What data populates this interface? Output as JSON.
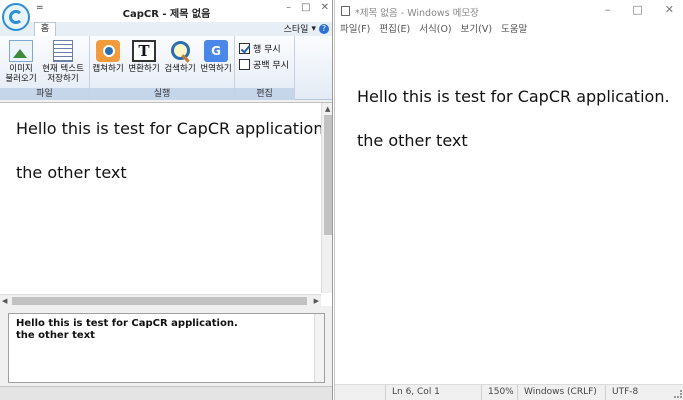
{
  "capcr": {
    "title": "CapCR - 제목 없음",
    "qat_symbol": "=",
    "window_controls": [
      "–",
      "□",
      "✕"
    ],
    "tab_home": "홈",
    "style_menu": "스타일",
    "style_arrow": "▾",
    "help_symbol": "?",
    "groups": {
      "file": {
        "label": "파일",
        "load_image": "이미지\n불러오기",
        "save_text": "현재 텍스트\n저장하기"
      },
      "run": {
        "label": "실행",
        "capture": "캡쳐하기",
        "convert": "변환하기",
        "search": "검색하기",
        "translate": "번역하기"
      },
      "edit": {
        "label": "편집",
        "ignore_lines": "행 무시",
        "ignore_spaces": "공백 무시"
      }
    },
    "translate_glyph": "G",
    "text_glyph": "T",
    "editor_text": "Hello this is test for CapCR application.\n\nthe other text",
    "result_text": "Hello this is test for CapCR application.\nthe other text"
  },
  "notepad": {
    "title": "*제목 없음 - Windows 메모장",
    "window_controls": [
      "–",
      "□",
      "✕"
    ],
    "menu": [
      "파일(F)",
      "편집(E)",
      "서식(O)",
      "보기(V)",
      "도움말"
    ],
    "doc_text": "Hello this is test for CapCR application.\n\nthe other text",
    "status": {
      "position": "Ln 6, Col 1",
      "zoom": "150%",
      "line_ending": "Windows (CRLF)",
      "encoding": "UTF-8"
    }
  }
}
